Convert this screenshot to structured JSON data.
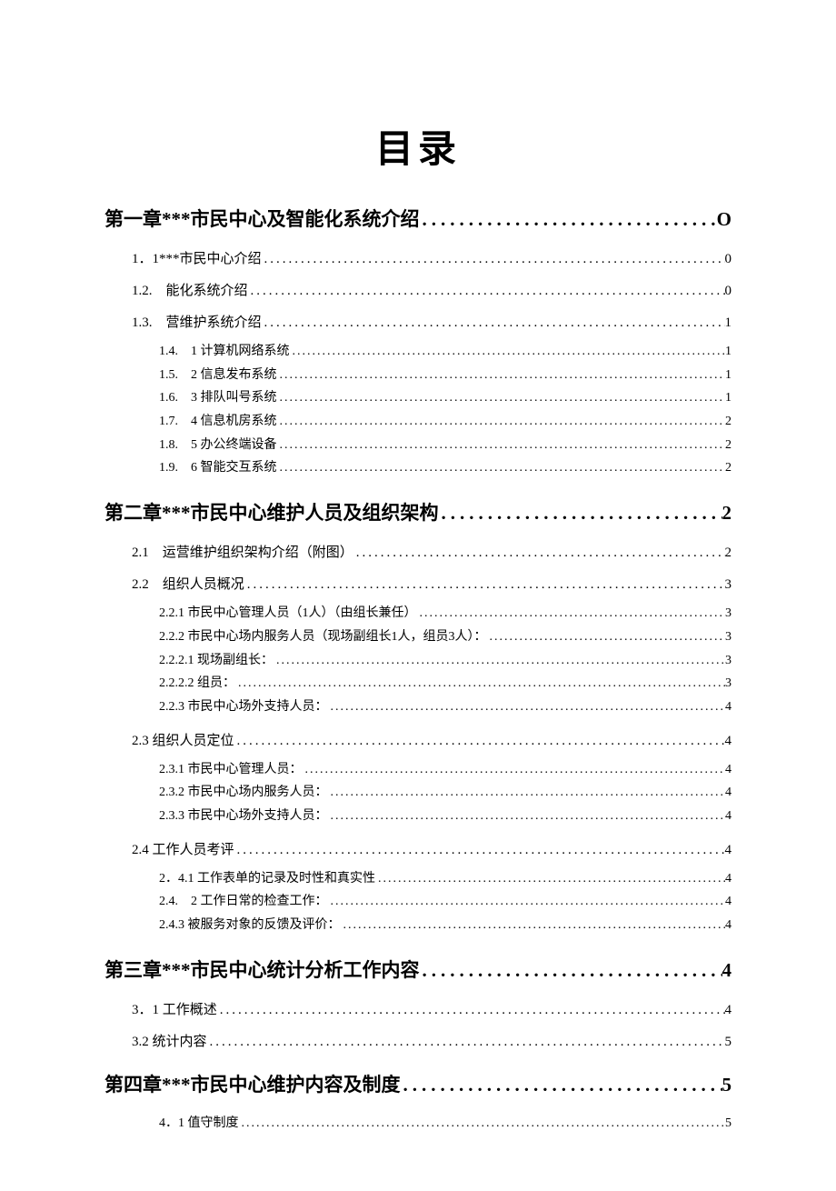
{
  "title": "目录",
  "entries": [
    {
      "level": 1,
      "label": "第一章***市民中心及智能化系统介绍",
      "page": "O"
    },
    {
      "level": 2,
      "label": "1．1***市民中心介绍",
      "page": "0"
    },
    {
      "level": 2,
      "label": "1.2.　能化系统介绍",
      "page": "0"
    },
    {
      "level": 2,
      "label": "1.3.　营维护系统介绍",
      "page": "1"
    },
    {
      "level": 3,
      "label": "1.4.　1 计算机网络系统",
      "page": "1",
      "gapBefore": true
    },
    {
      "level": 3,
      "label": "1.5.　2 信息发布系统",
      "page": "1"
    },
    {
      "level": 3,
      "label": "1.6.　3 排队叫号系统",
      "page": "1"
    },
    {
      "level": 3,
      "label": "1.7.　4 信息机房系统",
      "page": "2"
    },
    {
      "level": 3,
      "label": "1.8.　5 办公终端设备",
      "page": "2"
    },
    {
      "level": 3,
      "label": "1.9.　6 智能交互系统",
      "page": "2"
    },
    {
      "level": 1,
      "label": "第二章***市民中心维护人员及组织架构",
      "page": "2"
    },
    {
      "level": 2,
      "label": "2.1　运营维护组织架构介绍（附图）",
      "page": "2"
    },
    {
      "level": 2,
      "label": "2.2　组织人员概况",
      "page": "3"
    },
    {
      "level": 3,
      "label": "2.2.1 市民中心管理人员（1人）（由组长兼任）",
      "page": "3",
      "gapBefore": true
    },
    {
      "level": 3,
      "label": "2.2.2 市民中心场内服务人员（现场副组长1人，组员3人）：",
      "page": "3"
    },
    {
      "level": 3,
      "label": "2.2.2.1 现场副组长：",
      "page": "3"
    },
    {
      "level": 3,
      "label": "2.2.2.2 组员：",
      "page": "3"
    },
    {
      "level": 3,
      "label": "2.2.3 市民中心场外支持人员：",
      "page": "4"
    },
    {
      "level": 2,
      "label": "2.3 组织人员定位",
      "page": "4"
    },
    {
      "level": 3,
      "label": "2.3.1 市民中心管理人员：",
      "page": "4",
      "gapBefore": true
    },
    {
      "level": 3,
      "label": "2.3.2 市民中心场内服务人员：",
      "page": "4"
    },
    {
      "level": 3,
      "label": "2.3.3 市民中心场外支持人员：",
      "page": "4"
    },
    {
      "level": 2,
      "label": "2.4 工作人员考评",
      "page": "4"
    },
    {
      "level": 3,
      "label": "2．4.1 工作表单的记录及时性和真实性",
      "page": "4",
      "gapBefore": true
    },
    {
      "level": 3,
      "label": "2.4.　2 工作日常的检查工作：",
      "page": "4"
    },
    {
      "level": 3,
      "label": "2.4.3 被服务对象的反馈及评价：",
      "page": "4"
    },
    {
      "level": 1,
      "label": "第三章***市民中心统计分析工作内容",
      "page": "4"
    },
    {
      "level": 2,
      "label": "3．1 工作概述",
      "page": "4"
    },
    {
      "level": 2,
      "label": "3.2 统计内容",
      "page": "5"
    },
    {
      "level": 1,
      "label": "第四章***市民中心维护内容及制度",
      "page": "5"
    },
    {
      "level": 3,
      "label": "4．1 值守制度",
      "page": "5",
      "gapBefore": true
    }
  ]
}
